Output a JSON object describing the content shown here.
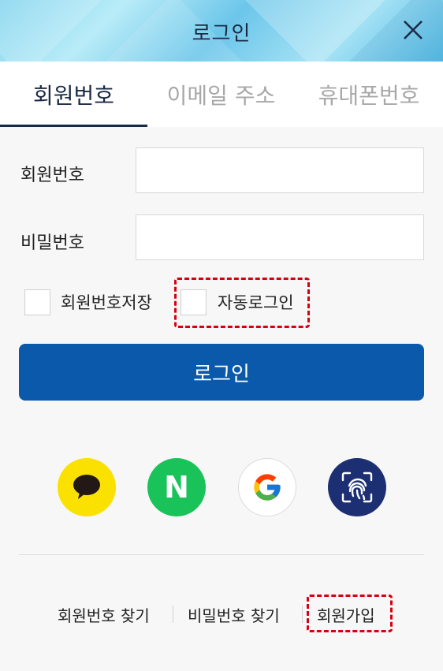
{
  "header": {
    "title": "로그인",
    "close_icon": "close-icon"
  },
  "tabs": [
    {
      "label": "회원번호",
      "active": true
    },
    {
      "label": "이메일 주소",
      "active": false
    },
    {
      "label": "휴대폰번호",
      "active": false
    }
  ],
  "form": {
    "member_number_label": "회원번호",
    "member_number_value": "",
    "password_label": "비밀번호",
    "password_value": "",
    "save_member_number_label": "회원번호저장",
    "save_member_number_checked": false,
    "auto_login_label": "자동로그인",
    "auto_login_checked": false,
    "login_button_label": "로그인"
  },
  "social_logins": [
    {
      "icon": "kakao-speech-bubble-icon",
      "color": "#fae100"
    },
    {
      "icon": "naver-n-icon",
      "color": "#19c35a",
      "glyph": "N"
    },
    {
      "icon": "google-g-icon",
      "color": "#ffffff"
    },
    {
      "icon": "fingerprint-icon",
      "color": "#1d2f73"
    }
  ],
  "footer": {
    "find_member_number": "회원번호 찾기",
    "find_password": "비밀번호 찾기",
    "sign_up": "회원가입"
  },
  "colors": {
    "primary": "#0a59ab",
    "highlight": "#d7000f",
    "tab_active": "#1b2a44"
  }
}
